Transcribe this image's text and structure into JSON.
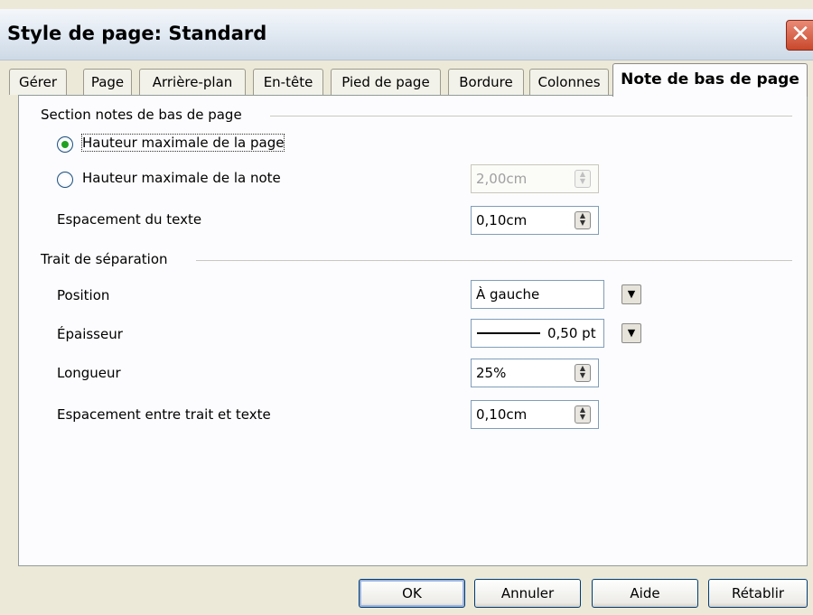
{
  "window": {
    "title": "Style de page: Standard",
    "close_glyph": "✕"
  },
  "tabs": [
    {
      "label": "Gérer"
    },
    {
      "label": "Page"
    },
    {
      "label": "Arrière-plan"
    },
    {
      "label": "En-tête"
    },
    {
      "label": "Pied de page"
    },
    {
      "label": "Bordure"
    },
    {
      "label": "Colonnes"
    },
    {
      "label": "Note de bas de page",
      "active": true
    }
  ],
  "footnote_section": {
    "heading": "Section notes de bas de page",
    "option_page_height": "Hauteur maximale de la page",
    "option_note_height": "Hauteur maximale de la note",
    "note_height_value": "2,00cm",
    "text_spacing_label": "Espacement du texte",
    "text_spacing_value": "0,10cm"
  },
  "separator_section": {
    "heading": "Trait de séparation",
    "position_label": "Position",
    "position_value": "À gauche",
    "thickness_label": "Épaisseur",
    "thickness_value": "0,50 pt",
    "length_label": "Longueur",
    "length_value": "25%",
    "spacing_label": "Espacement entre trait et texte",
    "spacing_value": "0,10cm"
  },
  "buttons": {
    "ok": "OK",
    "cancel": "Annuler",
    "help": "Aide",
    "reset": "Rétablir"
  },
  "icons": {
    "spin": "spin-arrows-icon",
    "dropdown": "chevron-down-icon",
    "close": "close-icon"
  },
  "colors": {
    "selected_radio": "#21a121",
    "titlebar": "#dde6f0",
    "close_button": "#c9482c"
  }
}
